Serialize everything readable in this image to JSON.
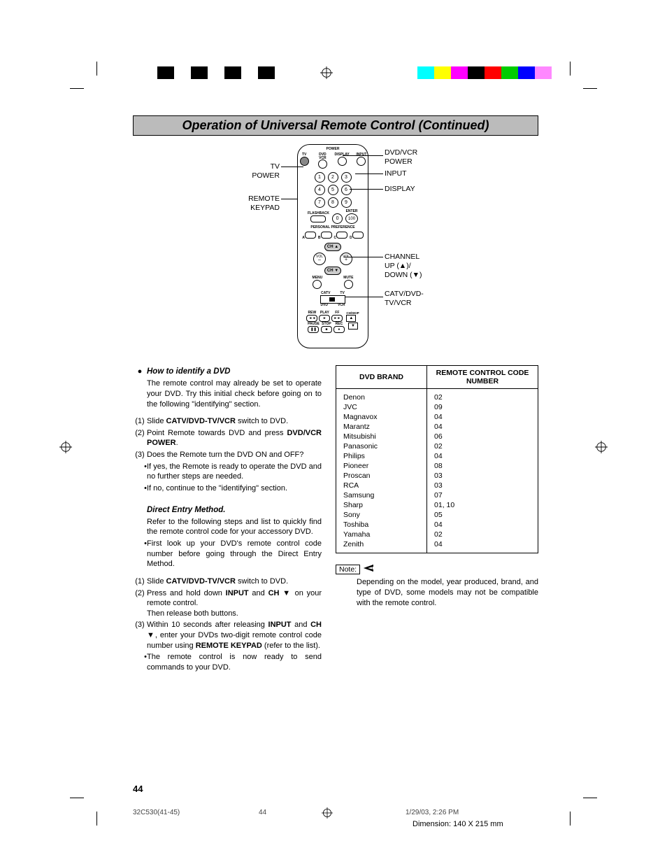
{
  "title": "Operation of Universal Remote Control (Continued)",
  "callouts": {
    "tv_power": "TV\nPOWER",
    "remote_keypad": "REMOTE\nKEYPAD",
    "dvd_vcr_power": "DVD/VCR\nPOWER",
    "input": "INPUT",
    "display": "DISPLAY",
    "channel": "CHANNEL\nUP (▲)/\nDOWN (▼)",
    "catv": "CATV/DVD-\nTV/VCR"
  },
  "remote_labels": {
    "power": "POWER",
    "tv": "TV",
    "dvd_vcr": "DVD\nVCR",
    "display": "DISPLAY",
    "input": "INPUT",
    "flashback": "FLASHBACK",
    "enter": "ENTER",
    "pref": "PERSONAL PREFERENCE",
    "abcd": [
      "A",
      "B",
      "C",
      "D"
    ],
    "ch_up": "CH ▲",
    "ch_dn": "CH ▼",
    "vol_minus": "VOL\n–",
    "vol_plus": "VOL\n+",
    "menu": "MENU",
    "mute": "MUTE",
    "switch_labels": [
      "CATV",
      "TV",
      "DVD",
      "VCR"
    ],
    "transport": [
      "REW",
      "PLAY",
      "FF"
    ],
    "transport_sym": [
      "◄◄",
      "►",
      "►►"
    ],
    "transport2": [
      "PAUSE",
      "STOP",
      "REC"
    ],
    "transport2_sym": [
      "❚❚",
      "■",
      "●"
    ],
    "chskip": "CH/SKIP"
  },
  "section1": {
    "heading": "How to identify a DVD",
    "intro": "The remote control may already be set to operate your DVD. Try this initial check before going on to the following \"identifying\" section.",
    "steps": [
      {
        "n": "(1)",
        "t_pre": "Slide ",
        "t_bold": "CATV/DVD-TV/VCR",
        "t_post": " switch to DVD."
      },
      {
        "n": "(2)",
        "t_pre": "Point Remote towards DVD and press ",
        "t_bold": "DVD/VCR POWER",
        "t_post": "."
      },
      {
        "n": "(3)",
        "t": "Does the Remote turn the DVD ON and OFF?"
      }
    ],
    "sub": [
      "If yes, the Remote is ready to operate the DVD and no further steps are needed.",
      "If no, continue to the \"identifying\" section."
    ]
  },
  "section2": {
    "heading": "Direct Entry Method.",
    "intro": "Refer to the following steps and list to quickly find the remote control code for your accessory DVD.",
    "bullet": "First look up your DVD's remote control code number before going through the Direct Entry Method.",
    "steps": {
      "s1_pre": "Slide ",
      "s1_bold": "CATV/DVD-TV/VCR",
      "s1_post": " switch to DVD.",
      "s2_a": "Press and hold down ",
      "s2_b": "INPUT",
      "s2_c": " and ",
      "s2_d": "CH",
      "s2_tri": " ▼ ",
      "s2_e": "on your remote control.",
      "s2_line2": "Then release both buttons.",
      "s3_a": "Within 10 seconds after releasing ",
      "s3_b": "INPUT",
      "s3_c": " and ",
      "s3_d": "CH",
      "s3_tri": " ▼",
      "s3_e": ", enter your DVDs two-digit remote control code number using ",
      "s3_f": "REMOTE KEYPAD",
      "s3_g": " (refer to the list).",
      "s3_bullet": "The remote control is now ready to send commands to your DVD."
    }
  },
  "table": {
    "headers": [
      "DVD BRAND",
      "REMOTE CONTROL CODE NUMBER"
    ],
    "rows": [
      [
        "Denon",
        "02"
      ],
      [
        "JVC",
        "09"
      ],
      [
        "Magnavox",
        "04"
      ],
      [
        "Marantz",
        "04"
      ],
      [
        "Mitsubishi",
        "06"
      ],
      [
        "Panasonic",
        "02"
      ],
      [
        "Philips",
        "04"
      ],
      [
        "Pioneer",
        "08"
      ],
      [
        "Proscan",
        "03"
      ],
      [
        "RCA",
        "03"
      ],
      [
        "Samsung",
        "07"
      ],
      [
        "Sharp",
        "01, 10"
      ],
      [
        "Sony",
        "05"
      ],
      [
        "Toshiba",
        "04"
      ],
      [
        "Yamaha",
        "02"
      ],
      [
        "Zenith",
        "04"
      ]
    ]
  },
  "note": {
    "label": "Note:",
    "text": "Depending on the model, year produced, brand, and type of DVD, some models may not be compatible with the remote control."
  },
  "page_number": "44",
  "footer": {
    "file": "32C530(41-45)",
    "page": "44",
    "timestamp": "1/29/03, 2:26 PM",
    "dimension": "Dimension: 140  X 215 mm"
  }
}
